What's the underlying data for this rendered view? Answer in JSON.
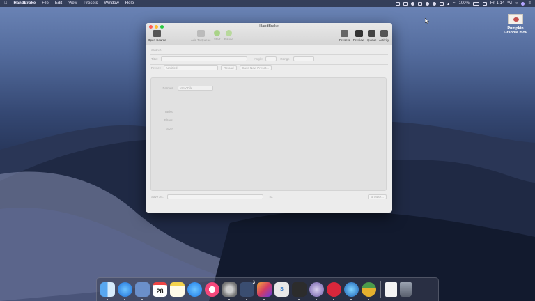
{
  "menubar": {
    "apple": "",
    "app_name": "HandBrake",
    "menus": [
      "File",
      "Edit",
      "View",
      "Presets",
      "Window",
      "Help"
    ],
    "battery": "100%",
    "clock": "Fri 1:14 PM"
  },
  "desktop_file": {
    "name_line1": "Pumpkin",
    "name_line2": "Granola.mov"
  },
  "window": {
    "title": "HandBrake",
    "toolbar": {
      "open_source": "Open Source",
      "add_to_queue": "Add To Queue",
      "start": "Start",
      "pause": "Pause",
      "presets": "Presets",
      "preview": "Preview",
      "queue": "Queue",
      "activity": "Activity"
    },
    "source_label": "Source:",
    "title_label": "Title:",
    "angle_label": "Angle:",
    "range_label": "Range:",
    "preset_label": "Preset:",
    "preset_value": "Untitled",
    "reload_button": "Reload",
    "save_new_preset_button": "Save New Preset...",
    "tabs": [
      "Summary",
      "Dimensions",
      "Filters",
      "Video",
      "Audio",
      "Subtitles",
      "Chapters"
    ],
    "active_tab": "Summary",
    "summary": {
      "format_label": "Format:",
      "format_value": "MKV File",
      "tracks_label": "Tracks:",
      "filters_label": "Filters:",
      "size_label": "Size:"
    },
    "save_as_label": "Save As:",
    "to_label": "To:",
    "browse_button": "Browse..."
  },
  "dock": {
    "calendar_day": "28",
    "badge_count": "3"
  },
  "colors": {
    "accent": "#3d8ef6",
    "close": "#fd5f57",
    "minimize": "#febb2e",
    "zoom": "#28c840",
    "start_green": "#7dbb3c"
  }
}
